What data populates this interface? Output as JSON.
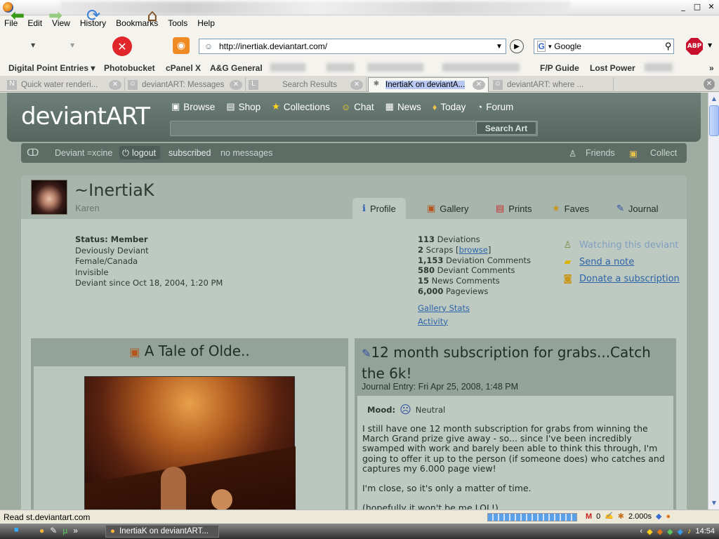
{
  "window": {
    "minimize": "_",
    "maximize": "□",
    "close": "✕"
  },
  "menu": [
    "File",
    "Edit",
    "View",
    "History",
    "Bookmarks",
    "Tools",
    "Help"
  ],
  "toolbar": {
    "url": "http://inertiak.deviantart.com/",
    "search_value": "Google",
    "abp": "ABP"
  },
  "bookmarks": [
    {
      "label": "Digital Point Entries ▾"
    },
    {
      "label": "Photobucket"
    },
    {
      "label": "cPanel X"
    },
    {
      "label": "A&G General"
    },
    {
      "label": "F/P Guide"
    },
    {
      "label": "Lost Power"
    }
  ],
  "tabs": [
    {
      "icon": "N",
      "label": "Quick water renderi..."
    },
    {
      "icon": "☺",
      "label": "deviantART: Messages"
    },
    {
      "icon": "L",
      "label": "Search Results"
    },
    {
      "icon": "✱",
      "label": "InertiaK on deviantA..."
    },
    {
      "icon": "☺",
      "label": "deviantART: where ..."
    }
  ],
  "da": {
    "logo": "deviantART",
    "nav": [
      {
        "icon": "▣",
        "label": "Browse"
      },
      {
        "icon": "▤",
        "label": "Shop"
      },
      {
        "icon": "★",
        "label": "Collections"
      },
      {
        "icon": "☺",
        "label": "Chat"
      },
      {
        "icon": "▦",
        "label": "News"
      },
      {
        "icon": "♦",
        "label": "Today"
      },
      {
        "icon": "◔",
        "label": "Forum"
      }
    ],
    "search_button": "Search Art",
    "substrip": {
      "deviant": "Deviant =xcine",
      "logout": "logout",
      "subscribed": "subscribed",
      "messages": "no messages",
      "friends": "Friends",
      "collect": "Collect"
    }
  },
  "profile": {
    "name": "~InertiaK",
    "realname": "Karen",
    "tabs": [
      {
        "icon": "ℹ",
        "label": "Profile"
      },
      {
        "icon": "▣",
        "label": "Gallery"
      },
      {
        "icon": "▤",
        "label": "Prints"
      },
      {
        "icon": "★",
        "label": "Faves"
      },
      {
        "icon": "✎",
        "label": "Journal"
      }
    ],
    "status_label": "Status: Member",
    "info": [
      "Deviously Deviant",
      "Female/Canada",
      "Invisible",
      "Deviant since Oct 18, 2004, 1:20 PM"
    ],
    "stats": [
      {
        "num": "113",
        "label": "Deviations"
      },
      {
        "num": "2",
        "label": "Scraps ["
      },
      {
        "num": "1,153",
        "label": "Deviation Comments"
      },
      {
        "num": "580",
        "label": "Deviant Comments"
      },
      {
        "num": "15",
        "label": "News Comments"
      },
      {
        "num": "6,000",
        "label": "Pageviews"
      }
    ],
    "browse": "browse",
    "browse_close": "]",
    "links": [
      "Gallery Stats",
      "Activity"
    ],
    "actions": [
      "Watching this deviant",
      "Send a note",
      "Donate a subscription"
    ]
  },
  "featured": {
    "title": "A Tale of Olde.."
  },
  "journal": {
    "title": "12 month subscription for grabs...Catch the 6k!",
    "meta": "Journal Entry: Fri Apr 25, 2008, 1:48 PM",
    "mood_label": "Mood:",
    "mood": "Neutral",
    "paragraphs": [
      "I still have one 12 month subscription for grabs from winning the March Grand prize give away - so... since I've been incredibly swamped with work and barely been able to think this through, I'm going to offer it up to the person (if someone does) who catches and captures my 6.000 page view!",
      "I'm close, so it's only a matter of time.",
      "(hopefully it won't be me LOL!)"
    ]
  },
  "status": {
    "text": "Read st.deviantart.com",
    "gmail": "0",
    "time": "2.000s"
  },
  "taskbar": {
    "task": "InertiaK on deviantART...",
    "clock": "14:54"
  }
}
